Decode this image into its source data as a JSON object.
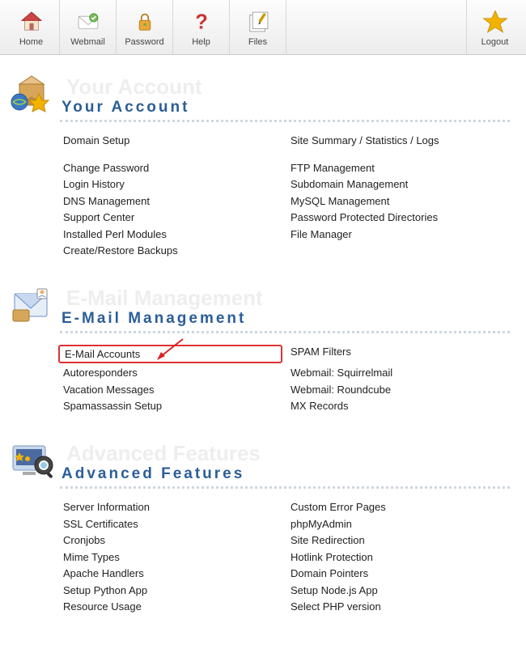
{
  "toolbar": {
    "home": "Home",
    "webmail": "Webmail",
    "password": "Password",
    "help": "Help",
    "files": "Files",
    "logout": "Logout"
  },
  "sections": {
    "account": {
      "title": "Your Account",
      "links_left": [
        "Domain Setup",
        "Change Password",
        "Login History",
        "DNS Management",
        "Support Center",
        "Installed Perl Modules",
        "Create/Restore Backups"
      ],
      "links_right": [
        "Site Summary / Statistics / Logs",
        "FTP Management",
        "Subdomain Management",
        "MySQL Management",
        "Password Protected Directories",
        "File Manager"
      ]
    },
    "email": {
      "title": "E-Mail Management",
      "links_left": [
        "E-Mail Accounts",
        "Autoresponders",
        "Vacation Messages",
        "Spamassassin Setup"
      ],
      "links_right": [
        "SPAM Filters",
        "Webmail: Squirrelmail",
        "Webmail: Roundcube",
        "MX Records"
      ],
      "highlighted": "E-Mail Accounts"
    },
    "advanced": {
      "title": "Advanced Features",
      "links_left": [
        "Server Information",
        "SSL Certificates",
        "Cronjobs",
        "Mime Types",
        "Apache Handlers",
        "Setup Python App",
        "Resource Usage"
      ],
      "links_right": [
        "Custom Error Pages",
        "phpMyAdmin",
        "Site Redirection",
        "Hotlink Protection",
        "Domain Pointers",
        "Setup Node.js App",
        "Select PHP version"
      ]
    }
  }
}
